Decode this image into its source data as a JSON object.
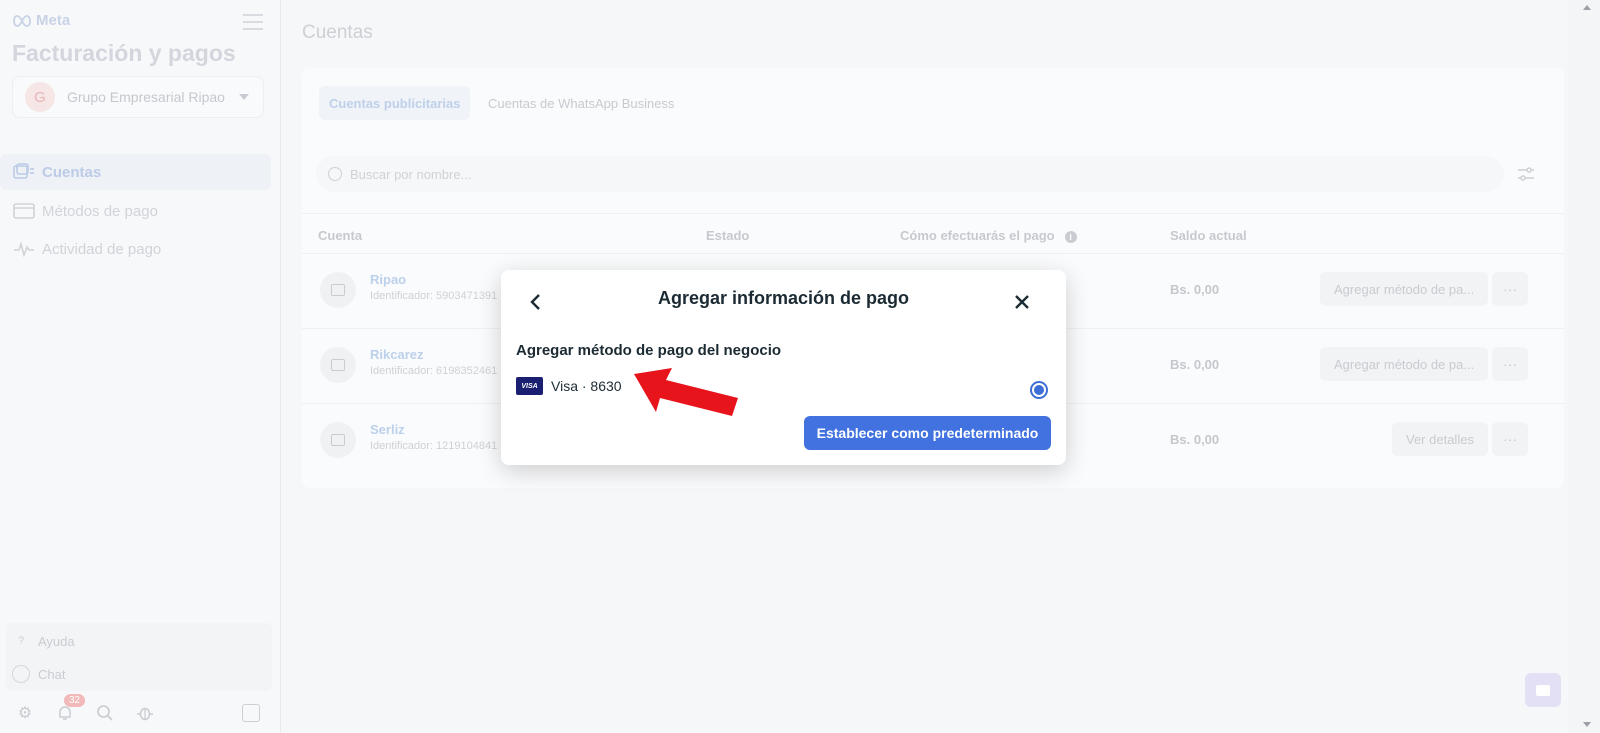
{
  "brand": {
    "name": "Meta"
  },
  "sidebar": {
    "title": "Facturación y pagos",
    "business": {
      "initial": "G",
      "name": "Grupo Empresarial Ripao"
    },
    "nav": [
      {
        "label": "Cuentas",
        "icon": "accounts-icon",
        "active": true
      },
      {
        "label": "Métodos de pago",
        "icon": "credit-card-icon",
        "active": false
      },
      {
        "label": "Actividad de pago",
        "icon": "activity-icon",
        "active": false
      }
    ],
    "bottom": [
      {
        "label": "Ayuda",
        "icon": "help-icon"
      },
      {
        "label": "Chat",
        "icon": "chat-icon"
      }
    ],
    "notification_count": "32"
  },
  "main": {
    "title": "Cuentas",
    "tabs": [
      "Cuentas publicitarias",
      "Cuentas de WhatsApp Business"
    ],
    "search_placeholder": "Buscar por nombre...",
    "columns": [
      "Cuenta",
      "Estado",
      "Cómo efectuarás el pago",
      "Saldo actual"
    ],
    "rows": [
      {
        "name": "Ripao",
        "id": "Identificador: 5903471391",
        "saldo": "Bs. 0,00",
        "action": "Agregar método de pa..."
      },
      {
        "name": "Rikcarez",
        "id": "Identificador: 6198352461",
        "saldo": "Bs. 0,00",
        "action": "Agregar método de pa..."
      },
      {
        "name": "Serliz",
        "id": "Identificador: 1219104841",
        "saldo": "Bs. 0,00",
        "action": "Ver detalles"
      }
    ],
    "more_label": "···"
  },
  "modal": {
    "title": "Agregar información de pago",
    "subtitle": "Agregar método de pago del negocio",
    "payment_method": {
      "brand": "VISA",
      "label": "Visa · 8630",
      "selected": true
    },
    "primary_button": "Establecer como predeterminado"
  },
  "colors": {
    "accent": "#4172df",
    "visa": "#1a1f71",
    "annotation_arrow": "#e8141c"
  }
}
